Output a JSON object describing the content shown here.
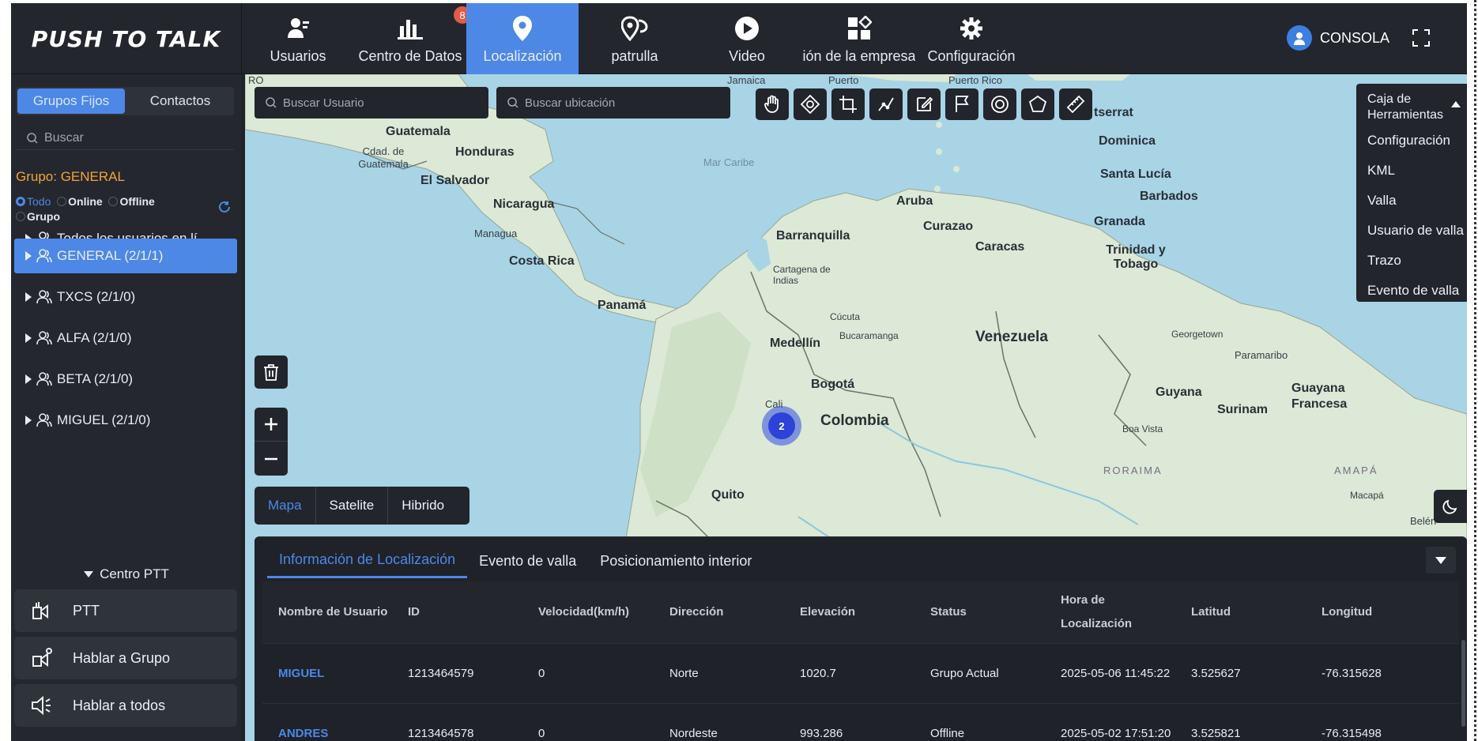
{
  "app": {
    "logo": "PUSH TO TALK",
    "user": "CONSOLA"
  },
  "nav": [
    {
      "label": "Usuarios",
      "icon": "users-icon"
    },
    {
      "label": "Centro de Datos",
      "icon": "bar-chart-icon",
      "badge": "8"
    },
    {
      "label": "Localización",
      "icon": "map-pin-icon",
      "active": true
    },
    {
      "label": "patrulla",
      "icon": "patrol-pin-icon"
    },
    {
      "label": "Video",
      "icon": "play-icon"
    },
    {
      "label": "ión de la empresa",
      "icon": "grid-icon"
    },
    {
      "label": "Configuración",
      "icon": "gear-icon"
    }
  ],
  "sidebar": {
    "tabs": [
      "Grupos Fijos",
      "Contactos"
    ],
    "search_placeholder": "Buscar",
    "group_title": "Grupo: GENERAL",
    "filters": [
      "Todo",
      "Online",
      "Offline",
      "Grupo"
    ],
    "groups": [
      "Todos los usuarios en lí...",
      "GENERAL (2/1/1)",
      "TXCS (2/1/0)",
      "ALFA (2/1/0)",
      "BETA (2/1/0)",
      "MIGUEL (2/1/0)"
    ],
    "ptt_header": "Centro PTT",
    "ptt_buttons": [
      "PTT",
      "Hablar a Grupo",
      "Hablar a todos"
    ]
  },
  "map": {
    "search_user_placeholder": "Buscar Usuario",
    "search_location_placeholder": "Buscar ubicación",
    "toolbox_title": "Caja de Herramientas",
    "toolbox_items": [
      "Configuración",
      "KML",
      "Valla",
      "Usuario de valla",
      "Trazo",
      "Evento de valla"
    ],
    "map_types": [
      "Mapa",
      "Satelite",
      "Hibrido"
    ],
    "cluster_count": "2",
    "labels": {
      "corner": "RO",
      "guatemala": "Guatemala",
      "cdad_guatemala": "Cdad. de Guatemala",
      "honduras": "Honduras",
      "el_salvador": "El Salvador",
      "nicaragua": "Nicaragua",
      "managua": "Managua",
      "costa_rica": "Costa Rica",
      "panama": "Panamá",
      "mar_caribe": "Mar Caribe",
      "aruba": "Aruba",
      "curazao": "Curazao",
      "barranquilla": "Barranquilla",
      "cartagena": "Cartagena de Indias",
      "caracas": "Caracas",
      "cucuta": "Cúcuta",
      "bucaramanga": "Bucaramanga",
      "medellin": "Medellín",
      "venezuela": "Venezuela",
      "bogota": "Bogotá",
      "colombia": "Colombia",
      "cali": "Cali",
      "quito": "Quito",
      "montserrat": "tserrat",
      "dominica": "Dominica",
      "santa_lucia": "Santa Lucía",
      "barbados": "Barbados",
      "granada": "Granada",
      "trinidad": "Trinidad y Tobago",
      "georgetown": "Georgetown",
      "paramaribo": "Paramaribo",
      "guyana": "Guyana",
      "surinam": "Surinam",
      "guayana_francesa": "Guayana Francesa",
      "boa_vista": "Boa Vista",
      "roraima": "RORAIMA",
      "amapa": "AMAPÁ",
      "macapa": "Macapá",
      "belen": "Belén",
      "puerto": "Puerto",
      "puerto_rico": "Puerto Rico",
      "jamaica": "Jamaica"
    }
  },
  "panel": {
    "tabs": [
      "Información de Localización",
      "Evento de valla",
      "Posicionamiento interior"
    ],
    "columns": [
      "Nombre de Usuario",
      "ID",
      "Velocidad(km/h)",
      "Dirección",
      "Elevación",
      "Status",
      "Hora de Localización",
      "Latitud",
      "Longitud"
    ],
    "rows": [
      [
        "MIGUEL",
        "1213464579",
        "0",
        "Norte",
        "1020.7",
        "Grupo Actual",
        "2025-05-06 11:45:22",
        "3.525627",
        "-76.315628"
      ],
      [
        "ANDRES",
        "1213464578",
        "0",
        "Nordeste",
        "993.286",
        "Offline",
        "2025-05-02 17:51:20",
        "3.525821",
        "-76.315498"
      ]
    ]
  },
  "colors": {
    "accent": "#4d88e6",
    "orange": "#f2a43a",
    "badge": "#e25a4a",
    "water": "#a8d4e6",
    "land": "#dbe9d6"
  }
}
